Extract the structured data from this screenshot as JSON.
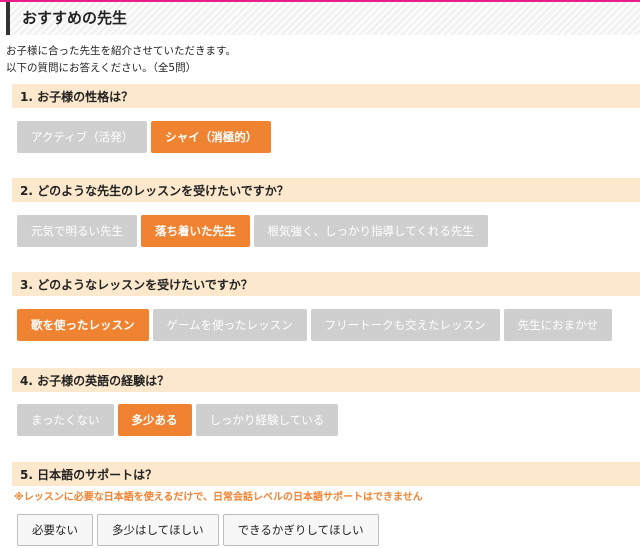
{
  "page_title": "おすすめの先生",
  "intro": {
    "line1": "お子様に合った先生を紹介させていただきます。",
    "line2": "以下の質問にお答えください。（全5問）"
  },
  "questions": [
    {
      "title": "1. お子様の性格は？",
      "options": [
        {
          "label": "アクティブ（活発）",
          "selected": false
        },
        {
          "label": "シャイ（消極的）",
          "selected": true
        }
      ]
    },
    {
      "title": "2. どのような先生のレッスンを受けたいですか？",
      "options": [
        {
          "label": "元気で明るい先生",
          "selected": false
        },
        {
          "label": "落ち着いた先生",
          "selected": true
        },
        {
          "label": "根気強く、しっかり指導してくれる先生",
          "selected": false
        }
      ]
    },
    {
      "title": "3. どのようなレッスンを受けたいですか？",
      "options": [
        {
          "label": "歌を使ったレッスン",
          "selected": true
        },
        {
          "label": "ゲームを使ったレッスン",
          "selected": false
        },
        {
          "label": "フリートークも交えたレッスン",
          "selected": false
        },
        {
          "label": "先生におまかせ",
          "selected": false
        }
      ]
    },
    {
      "title": "4. お子様の英語の経験は？",
      "options": [
        {
          "label": "まったくない",
          "selected": false
        },
        {
          "label": "多少ある",
          "selected": true
        },
        {
          "label": "しっかり経験している",
          "selected": false
        }
      ]
    },
    {
      "title": "5. 日本語のサポートは？",
      "note": "※レッスンに必要な日本語を使えるだけで、日常会話レベルの日本語サポートはできません",
      "options": [
        {
          "label": "必要ない",
          "selected": false
        },
        {
          "label": "多少はしてほしい",
          "selected": false
        },
        {
          "label": "できるかぎりしてほしい",
          "selected": false
        }
      ]
    }
  ],
  "colors": {
    "accent": "#f08332",
    "unselected": "#cfcfcf",
    "header_bg": "#fce8cc",
    "top_stripe": "#e91e8c"
  }
}
